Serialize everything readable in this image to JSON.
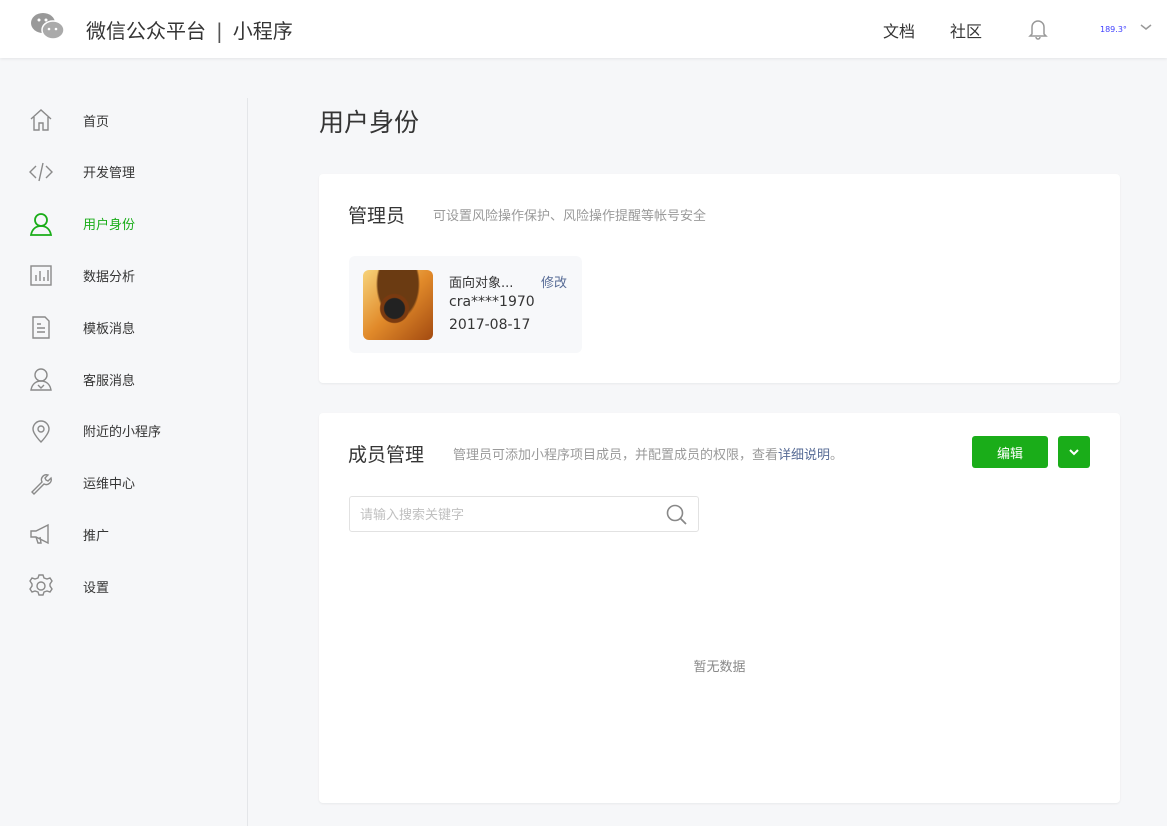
{
  "header": {
    "brand": "微信公众平台",
    "separator": "|",
    "product": "小程序",
    "nav": [
      "文档",
      "社区"
    ],
    "user": "189.3°"
  },
  "sidebar": {
    "items": [
      {
        "label": "首页",
        "icon": "home-icon"
      },
      {
        "label": "开发管理",
        "icon": "code-icon"
      },
      {
        "label": "用户身份",
        "icon": "user-icon",
        "active": true
      },
      {
        "label": "数据分析",
        "icon": "chart-icon"
      },
      {
        "label": "模板消息",
        "icon": "document-icon"
      },
      {
        "label": "客服消息",
        "icon": "support-icon"
      },
      {
        "label": "附近的小程序",
        "icon": "location-icon"
      },
      {
        "label": "运维中心",
        "icon": "wrench-icon"
      },
      {
        "label": "推广",
        "icon": "megaphone-icon"
      },
      {
        "label": "设置",
        "icon": "gear-icon"
      }
    ]
  },
  "page": {
    "title": "用户身份"
  },
  "admin": {
    "title": "管理员",
    "desc": "可设置风险操作保护、风险操作提醒等帐号安全",
    "name": "面向对象...",
    "edit": "修改",
    "id": "cra****1970",
    "date": "2017-08-17"
  },
  "members": {
    "title": "成员管理",
    "desc": "管理员可添加小程序项目成员，并配置成员的权限，查看",
    "link": "详细说明",
    "desc_end": "。",
    "edit": "编辑",
    "search_placeholder": "请输入搜索关键字",
    "empty": "暂无数据"
  },
  "colors": {
    "accent": "#1aad19",
    "link": "#576b95"
  }
}
